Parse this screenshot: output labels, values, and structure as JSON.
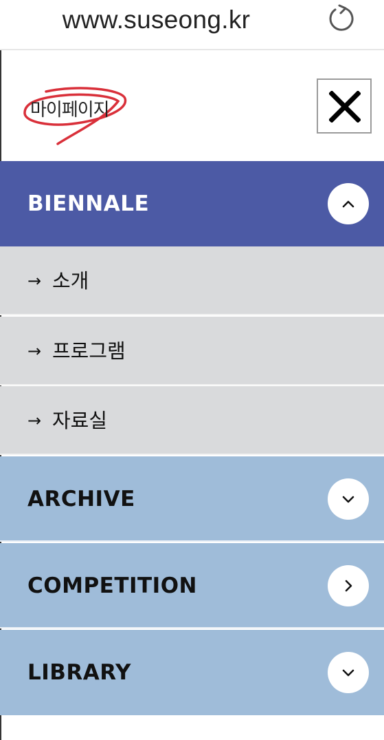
{
  "browser": {
    "url": "www.suseong.kr",
    "reload_icon": "reload-icon"
  },
  "menu": {
    "mypage_label": "마이페이지",
    "close_icon": "close-icon",
    "categories": [
      {
        "label": "BIENNALE",
        "state": "expanded",
        "toggle_icon": "chevron-up-icon",
        "items": [
          {
            "arrow": "→",
            "label": "소개"
          },
          {
            "arrow": "→",
            "label": "프로그램"
          },
          {
            "arrow": "→",
            "label": "자료실"
          }
        ]
      },
      {
        "label": "ARCHIVE",
        "state": "collapsed",
        "toggle_icon": "chevron-down-icon"
      },
      {
        "label": "COMPETITION",
        "state": "link",
        "toggle_icon": "chevron-right-icon"
      },
      {
        "label": "LIBRARY",
        "state": "collapsed",
        "toggle_icon": "chevron-down-icon"
      }
    ]
  },
  "colors": {
    "biennale_bg": "#4c5aa5",
    "category_bg": "#9fbcd9",
    "submenu_bg": "#d9dadc",
    "scribble": "#d9303a"
  }
}
